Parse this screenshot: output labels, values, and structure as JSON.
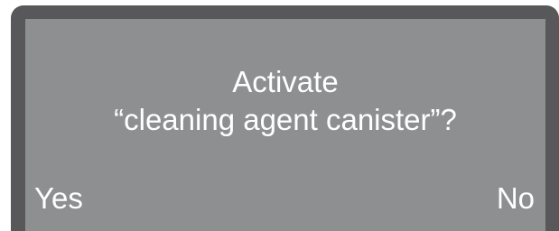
{
  "dialog": {
    "title_line1": "Activate",
    "title_line2": "“cleaning agent canister”?"
  },
  "softkeys": {
    "left_label": "Yes",
    "right_label": "No"
  },
  "colors": {
    "bezel": "#58585a",
    "screen": "#8e8f91",
    "text": "#ffffff"
  }
}
